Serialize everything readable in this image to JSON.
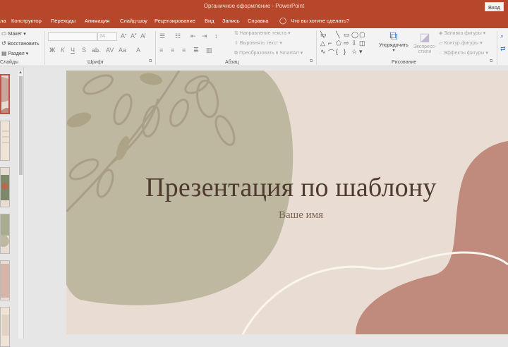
{
  "window": {
    "title": "Органичное оформление  -  PowerPoint",
    "signin_label": "Вход"
  },
  "menu": {
    "items": [
      "ла",
      "Конструктор",
      "Переходы",
      "Анимация",
      "Слайд-шоу",
      "Рецензирование",
      "Вид",
      "Запись",
      "Справка"
    ],
    "tell_me": "Что вы хотите сделать?"
  },
  "ribbon": {
    "slides": {
      "layout": "Макет",
      "reset": "Восстановить",
      "section": "Раздел",
      "group_label": "Слайды"
    },
    "font": {
      "size": "24",
      "group_label": "Шрифт"
    },
    "paragraph": {
      "text_direction": "Направление текста",
      "align_text": "Выровнять текст",
      "smartart": "Преобразовать в SmartArt",
      "group_label": "Абзац"
    },
    "drawing": {
      "arrange": "Упорядочить",
      "quick_styles_1": "Экспресс-",
      "quick_styles_2": "стили",
      "shape_fill": "Заливка фигуры",
      "shape_outline": "Контур фигуры",
      "shape_effects": "Эффекты фигуры",
      "group_label": "Рисование"
    }
  },
  "slide": {
    "title": "Презентация по шаблону",
    "subtitle": "Ваше имя"
  },
  "colors": {
    "accent": "#b7472a",
    "slide_bg": "#e9ddd3",
    "sage": "#bfb8a0",
    "terracotta": "#c08b7d"
  }
}
